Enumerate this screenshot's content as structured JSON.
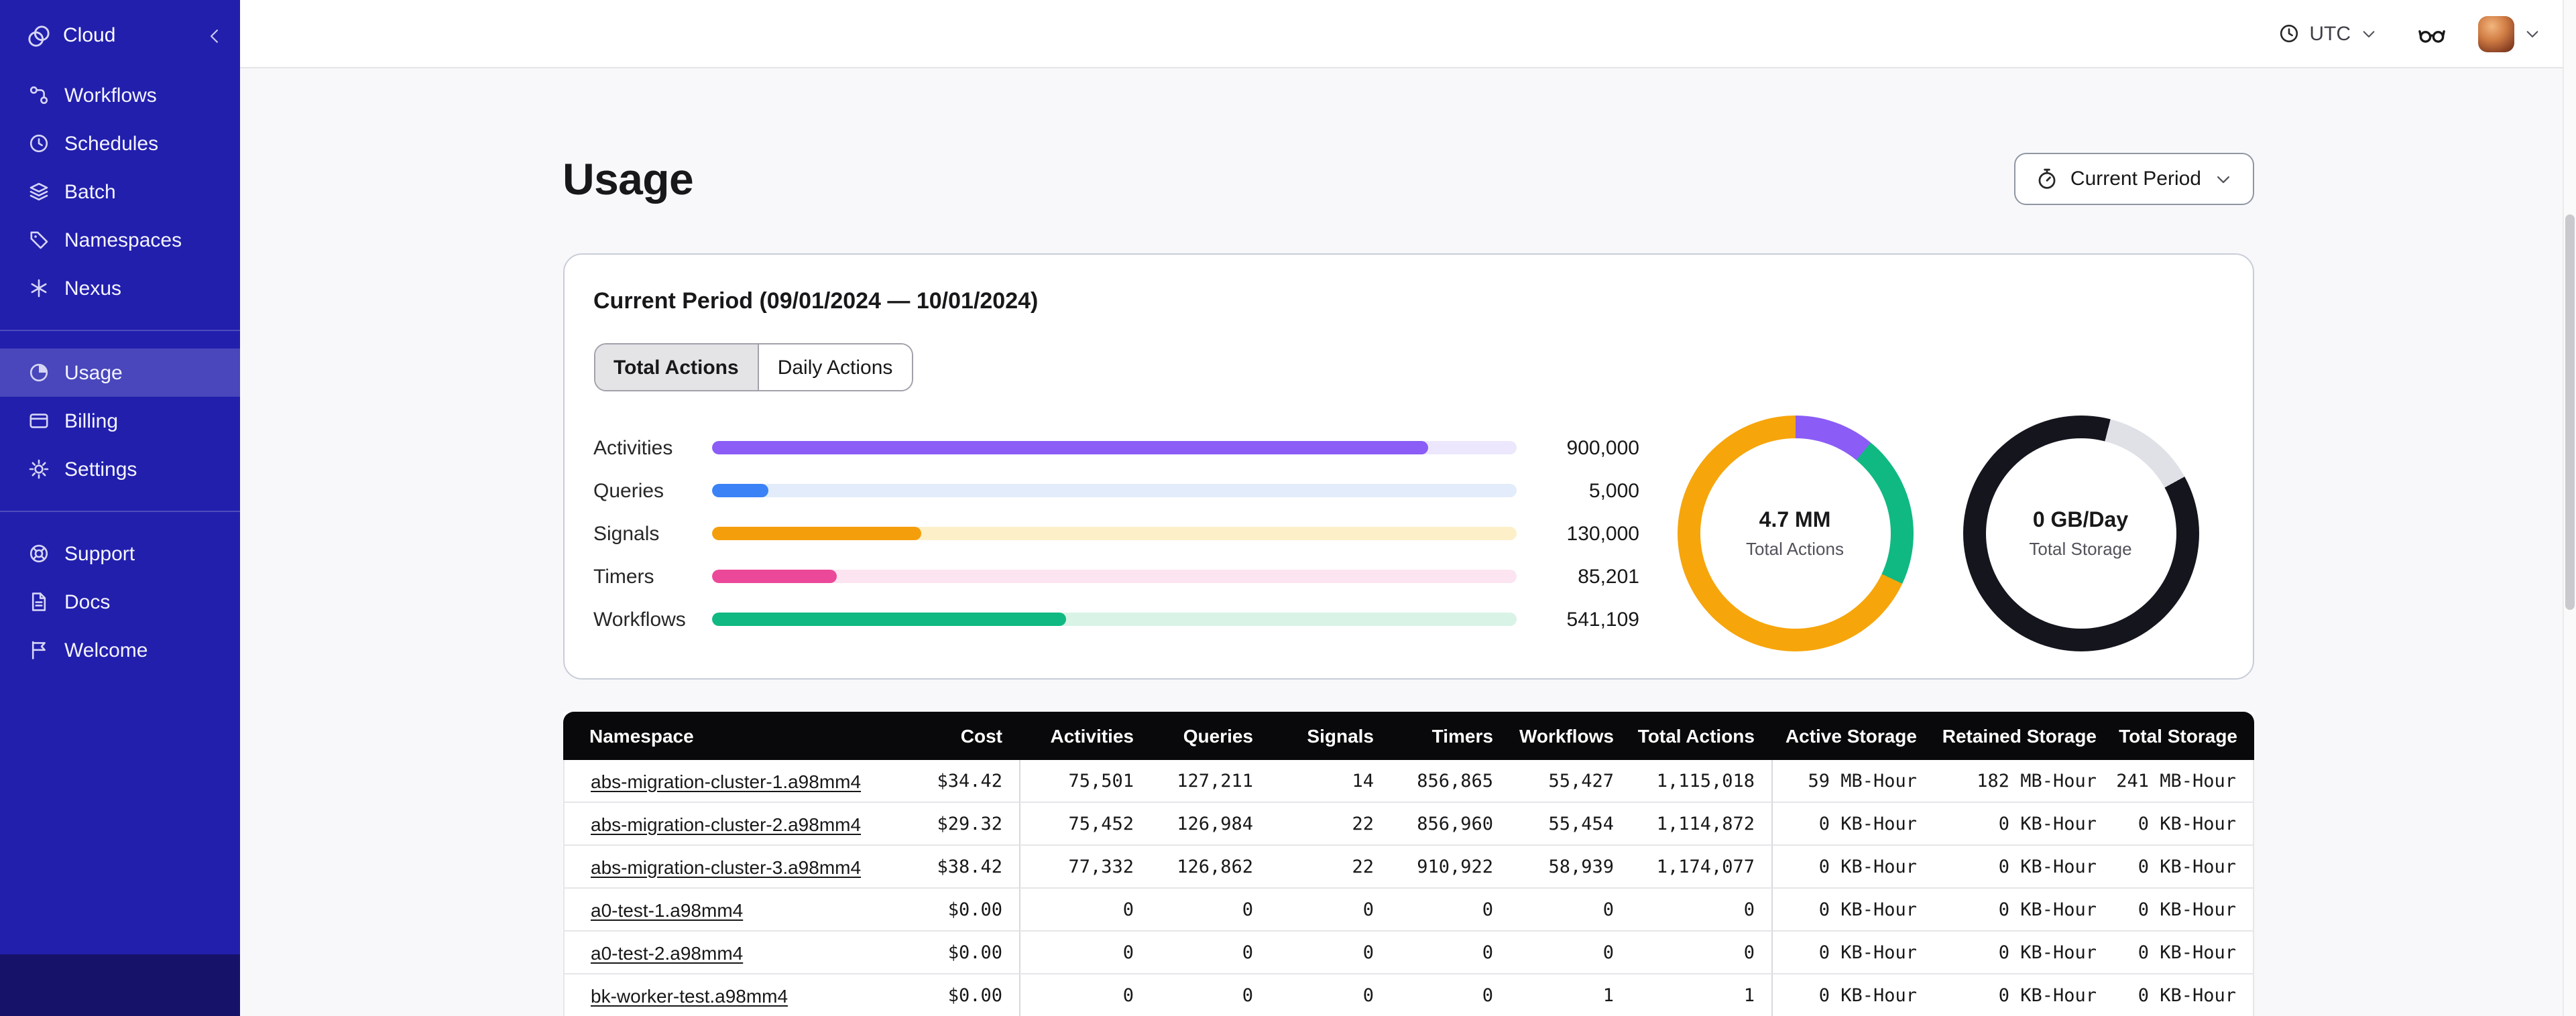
{
  "sidebar": {
    "brand": "Cloud",
    "nav_main": [
      {
        "label": "Workflows",
        "icon": "workflows-icon",
        "active": false
      },
      {
        "label": "Schedules",
        "icon": "schedules-icon",
        "active": false
      },
      {
        "label": "Batch",
        "icon": "batch-icon",
        "active": false
      },
      {
        "label": "Namespaces",
        "icon": "namespaces-icon",
        "active": false
      },
      {
        "label": "Nexus",
        "icon": "nexus-icon",
        "active": false
      }
    ],
    "nav_account": [
      {
        "label": "Usage",
        "icon": "usage-icon",
        "active": true
      },
      {
        "label": "Billing",
        "icon": "billing-icon",
        "active": false
      },
      {
        "label": "Settings",
        "icon": "settings-icon",
        "active": false
      }
    ],
    "nav_help": [
      {
        "label": "Support",
        "icon": "support-icon",
        "active": false
      },
      {
        "label": "Docs",
        "icon": "docs-icon",
        "active": false
      },
      {
        "label": "Welcome",
        "icon": "welcome-icon",
        "active": false
      }
    ]
  },
  "topbar": {
    "timezone": "UTC"
  },
  "page": {
    "title": "Usage",
    "period_button": "Current Period"
  },
  "usage_card": {
    "title": "Current Period (09/01/2024 — 10/01/2024)",
    "tabs": [
      {
        "label": "Total Actions",
        "active": true
      },
      {
        "label": "Daily Actions",
        "active": false
      }
    ]
  },
  "chart_data": [
    {
      "type": "bar",
      "orientation": "horizontal",
      "categories": [
        "Activities",
        "Queries",
        "Signals",
        "Timers",
        "Workflows"
      ],
      "values": [
        900000,
        5000,
        130000,
        85201,
        541109
      ],
      "value_labels": [
        "900,000",
        "5,000",
        "130,000",
        "85,201",
        "541,109"
      ],
      "bar_percents": [
        89,
        7,
        26,
        15.5,
        44
      ],
      "colors": [
        "#8b5cf6",
        "#3b82f6",
        "#f59e0b",
        "#ec4899",
        "#10b981"
      ],
      "track_colors": [
        "#ece7fc",
        "#e3ecfb",
        "#fdf0c9",
        "#fce4f1",
        "#d9f3e7"
      ]
    },
    {
      "type": "pie",
      "center_value": "4.7 MM",
      "center_label": "Total Actions",
      "segments": [
        {
          "color": "#8b5cf6",
          "pct": 11
        },
        {
          "color": "#10b981",
          "pct": 21
        },
        {
          "color": "#f6a50b",
          "pct": 68
        }
      ]
    },
    {
      "type": "pie",
      "center_value": "0 GB/Day",
      "center_label": "Total Storage",
      "segments": [
        {
          "color": "#15151e",
          "pct": 4
        },
        {
          "color": "#dfe1e6",
          "pct": 13
        },
        {
          "color": "#15151e",
          "pct": 83
        }
      ]
    }
  ],
  "table": {
    "columns": [
      "Namespace",
      "Cost",
      "Activities",
      "Queries",
      "Signals",
      "Timers",
      "Workflows",
      "Total Actions",
      "Active Storage",
      "Retained Storage",
      "Total Storage"
    ],
    "rows": [
      [
        "abs-migration-cluster-1.a98mm4",
        "$34.42",
        "75,501",
        "127,211",
        "14",
        "856,865",
        "55,427",
        "1,115,018",
        "59 MB-Hour",
        "182 MB-Hour",
        "241 MB-Hour"
      ],
      [
        "abs-migration-cluster-2.a98mm4",
        "$29.32",
        "75,452",
        "126,984",
        "22",
        "856,960",
        "55,454",
        "1,114,872",
        "0 KB-Hour",
        "0 KB-Hour",
        "0 KB-Hour"
      ],
      [
        "abs-migration-cluster-3.a98mm4",
        "$38.42",
        "77,332",
        "126,862",
        "22",
        "910,922",
        "58,939",
        "1,174,077",
        "0 KB-Hour",
        "0 KB-Hour",
        "0 KB-Hour"
      ],
      [
        "a0-test-1.a98mm4",
        "$0.00",
        "0",
        "0",
        "0",
        "0",
        "0",
        "0",
        "0 KB-Hour",
        "0 KB-Hour",
        "0 KB-Hour"
      ],
      [
        "a0-test-2.a98mm4",
        "$0.00",
        "0",
        "0",
        "0",
        "0",
        "0",
        "0",
        "0 KB-Hour",
        "0 KB-Hour",
        "0 KB-Hour"
      ],
      [
        "bk-worker-test.a98mm4",
        "$0.00",
        "0",
        "0",
        "0",
        "0",
        "1",
        "1",
        "0 KB-Hour",
        "0 KB-Hour",
        "0 KB-Hour"
      ]
    ]
  }
}
